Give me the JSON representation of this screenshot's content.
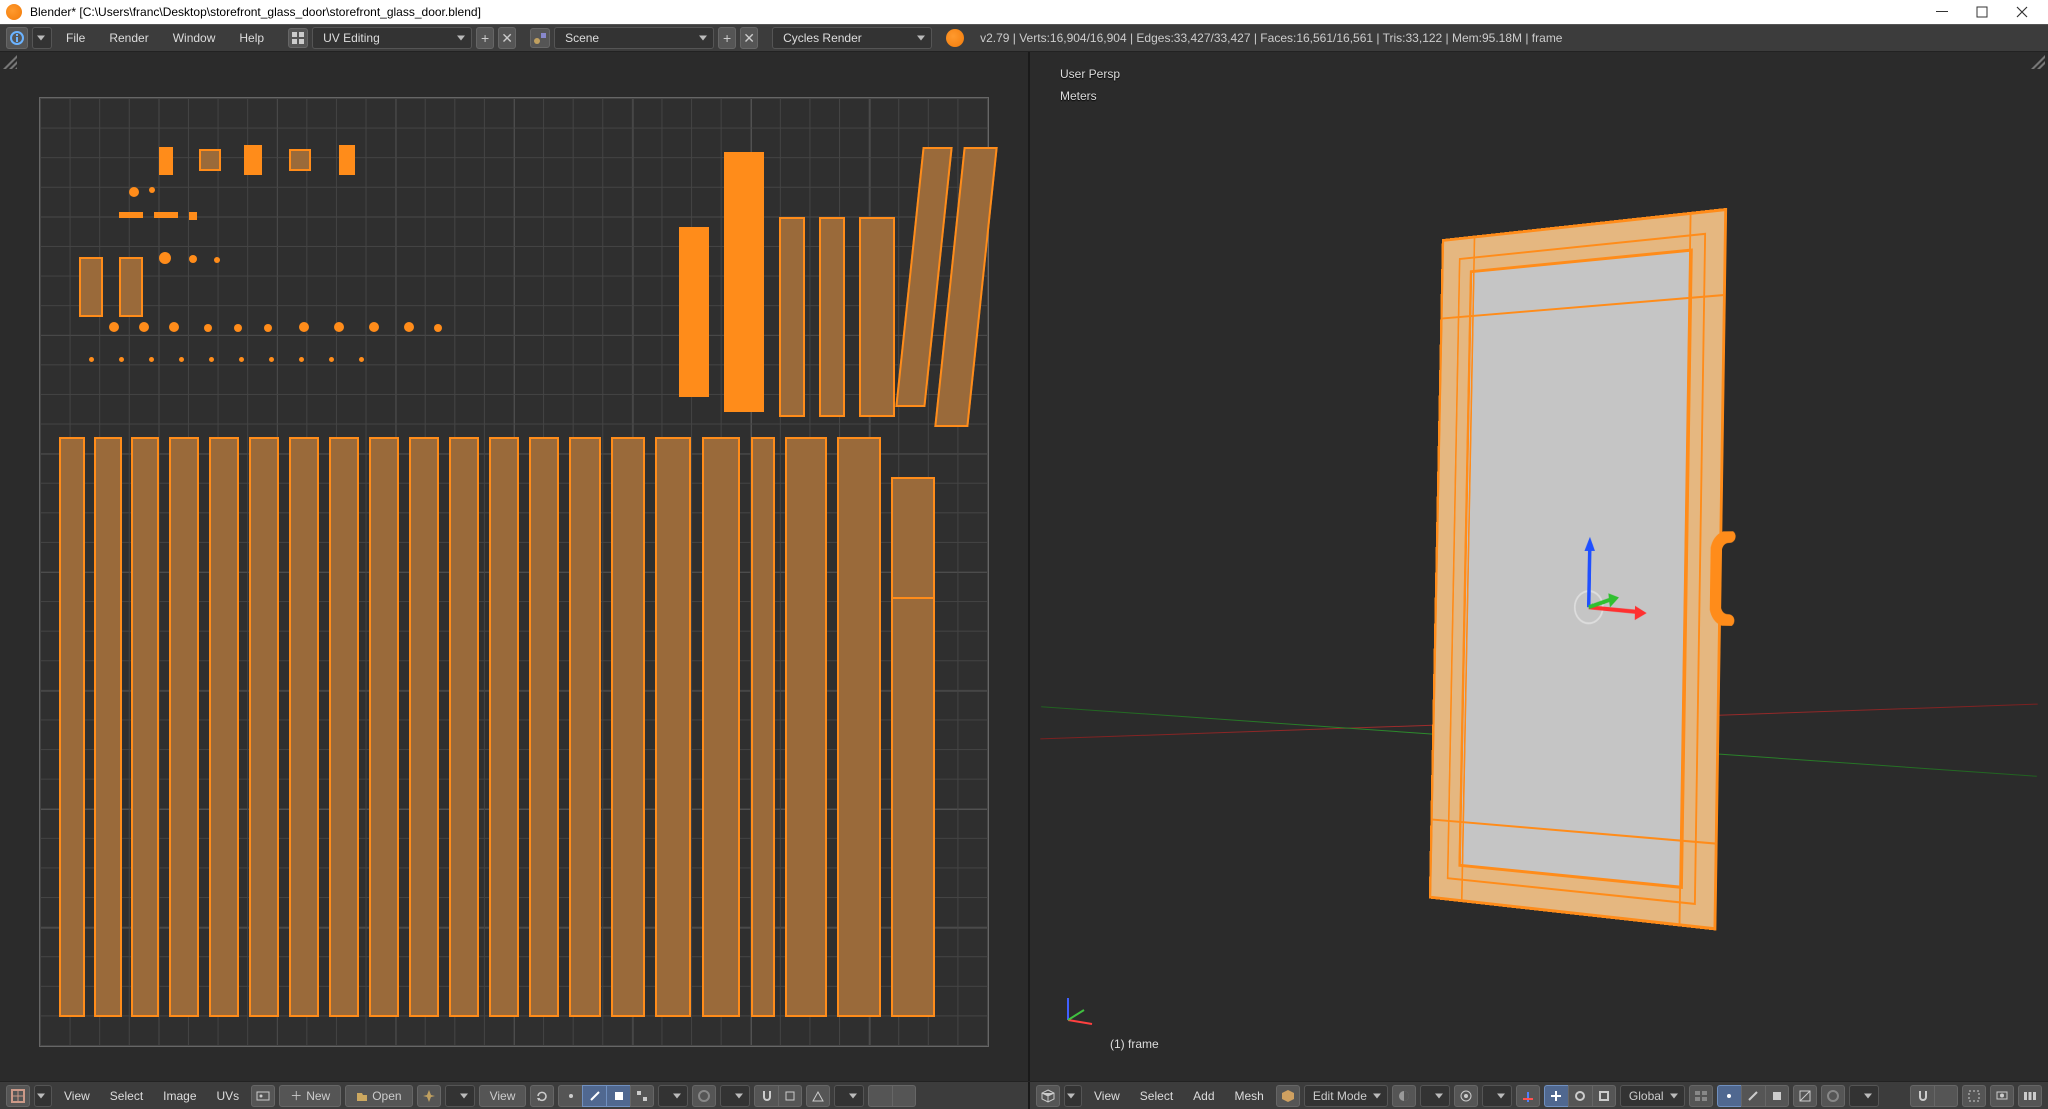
{
  "title": "Blender* [C:\\Users\\franc\\Desktop\\storefront_glass_door\\storefront_glass_door.blend]",
  "menu": {
    "file": "File",
    "render": "Render",
    "window": "Window",
    "help": "Help"
  },
  "layout": "UV Editing",
  "scene": "Scene",
  "engine": "Cycles Render",
  "stats_line": "v2.79 | Verts:16,904/16,904 | Edges:33,427/33,427 | Faces:16,561/16,561 | Tris:33,122 | Mem:95.18M | frame",
  "view3d": {
    "persp": "User Persp",
    "units": "Meters",
    "frame_label": "(1) frame"
  },
  "uv_toolbar": {
    "view": "View",
    "select": "Select",
    "image": "Image",
    "uvs": "UVs",
    "new": "New",
    "open": "Open",
    "view2": "View"
  },
  "v3d_toolbar": {
    "view": "View",
    "select": "Select",
    "add": "Add",
    "mesh": "Mesh",
    "mode": "Edit Mode",
    "orientation": "Global"
  },
  "colors": {
    "accent": "#ff8c1a",
    "island": "#9a6a3a",
    "panel": "#3c3c3c"
  }
}
